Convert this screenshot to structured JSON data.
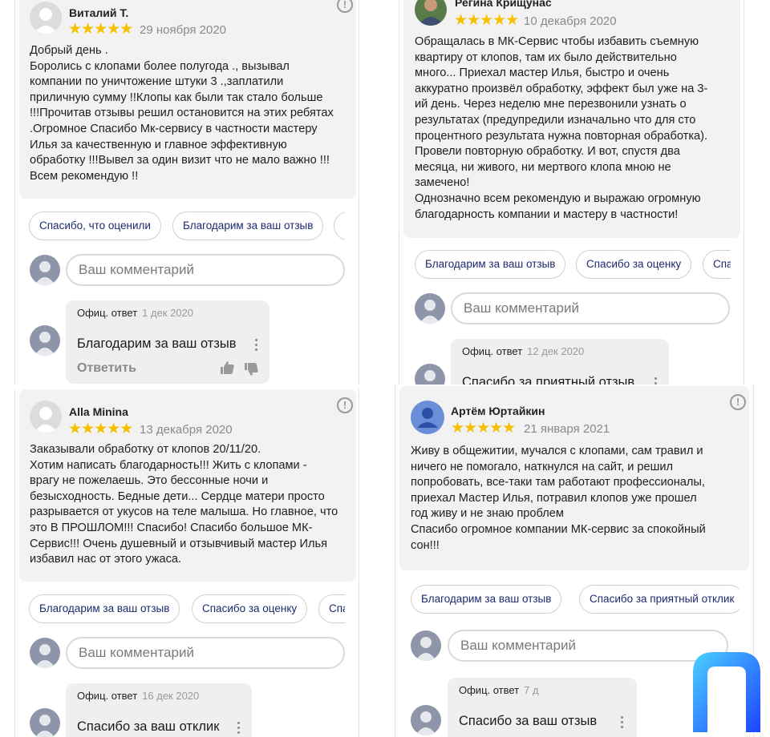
{
  "placeholder": "Ваш комментарий",
  "reply_label": "Офиц. ответ",
  "answer_label": "Ответить",
  "warn_glyph": "!",
  "star_glyph": "★★★★★",
  "reviews": [
    {
      "name": "Виталий Т.",
      "date": "29 ноября 2020",
      "text": "Добрый день .\nБоролись с клопами более полугода ., вызывал\nкомпании по уничтожение штуки 3 .,заплатили\nприличную сумму !!Клопы как были так стало больше\n!!!Прочитав отзывы решил остановится на этих ребятах\n.Огромное Спасибо Мк-сервису в частности мастеру\nИлья за качественную и главное эффективную\nобработку !!!Вывел за один визит что не мало важно !!!\nВсем рекомендую !!",
      "chips": [
        "Спасибо, что оценили",
        "Благодарим за ваш отзыв",
        "Пр"
      ],
      "reply_date": "1 дек 2020",
      "reply_text": "Благодарим за ваш отзыв"
    },
    {
      "name": "Регина Крищунас",
      "date": "10 декабря 2020",
      "text": "Обращалась в МК-Сервис чтобы избавить съемную\nквартиру от клопов, там их было действительно\nмного... Приехал мастер Илья, быстро и очень\nаккуратно произвёл обработку, эффект был уже на 3-\nий день. Через неделю мне перезвонили узнать о\nрезультатах (предупредили изначально что для сто\nпроцентного результата нужна повторная обработка).\nПровели повторную обработку. И вот, спустя два\nмесяца, ни живого, ни мертвого клопа мною не\nзамечено!\nОднозначно всем рекомендую и выражаю огромную\nблагодарность компании и мастеру в частности!",
      "chips": [
        "Благодарим за ваш отзыв",
        "Спасибо за оценку",
        "Спа"
      ],
      "reply_date": "12 дек 2020",
      "reply_text": "Спасибо за приятный отзыв"
    },
    {
      "name": "Alla Minina",
      "date": "13 декабря 2020",
      "text": "Заказывали обработку от клопов 20/11/20.\nХотим написать благодарность!!! Жить с клопами -\nврагу не пожелаешь. Это бессонные ночи и\nбезысходность. Бедные дети... Сердце матери просто\nразрывается от укусов на теле малыша. Но главное, что\nэто В ПРОШЛОМ!!! Спасибо! Спасибо большое МК-\nСервис!!! Очень душевный и отзывчивый мастер Илья\nизбавил нас от этого ужаса.",
      "chips": [
        "Благодарим за ваш отзыв",
        "Спасибо за оценку",
        "Спа"
      ],
      "reply_date": "16 дек 2020",
      "reply_text": "Спасибо за ваш отклик"
    },
    {
      "name": "Артём Юртайкин",
      "date": "21 января 2021",
      "text": "Живу в общежитии, мучался с клопами, сам травил и\nничего не помогало, наткнулся на сайт, и решил\nпопробовать, все-таки там работают профессионалы,\nприехал Мастер Илья, потравил клопов уже прошел\nгод живу и не знаю проблем\nСпасибо огромное компании МК-сервис за спокойный\nсон!!!",
      "chips": [
        "Благодарим за ваш отзыв",
        "Спасибо за приятный отклик"
      ],
      "reply_date": "7 д",
      "reply_text": "Спасибо за ваш отзыв"
    }
  ],
  "colors": {
    "star": "#f6c000",
    "chip_text": "#1c2a6e",
    "card_bg": "#f2f2f2",
    "avatar_blue": "#6b8ed8",
    "logo_blue": "#1e6bff"
  }
}
